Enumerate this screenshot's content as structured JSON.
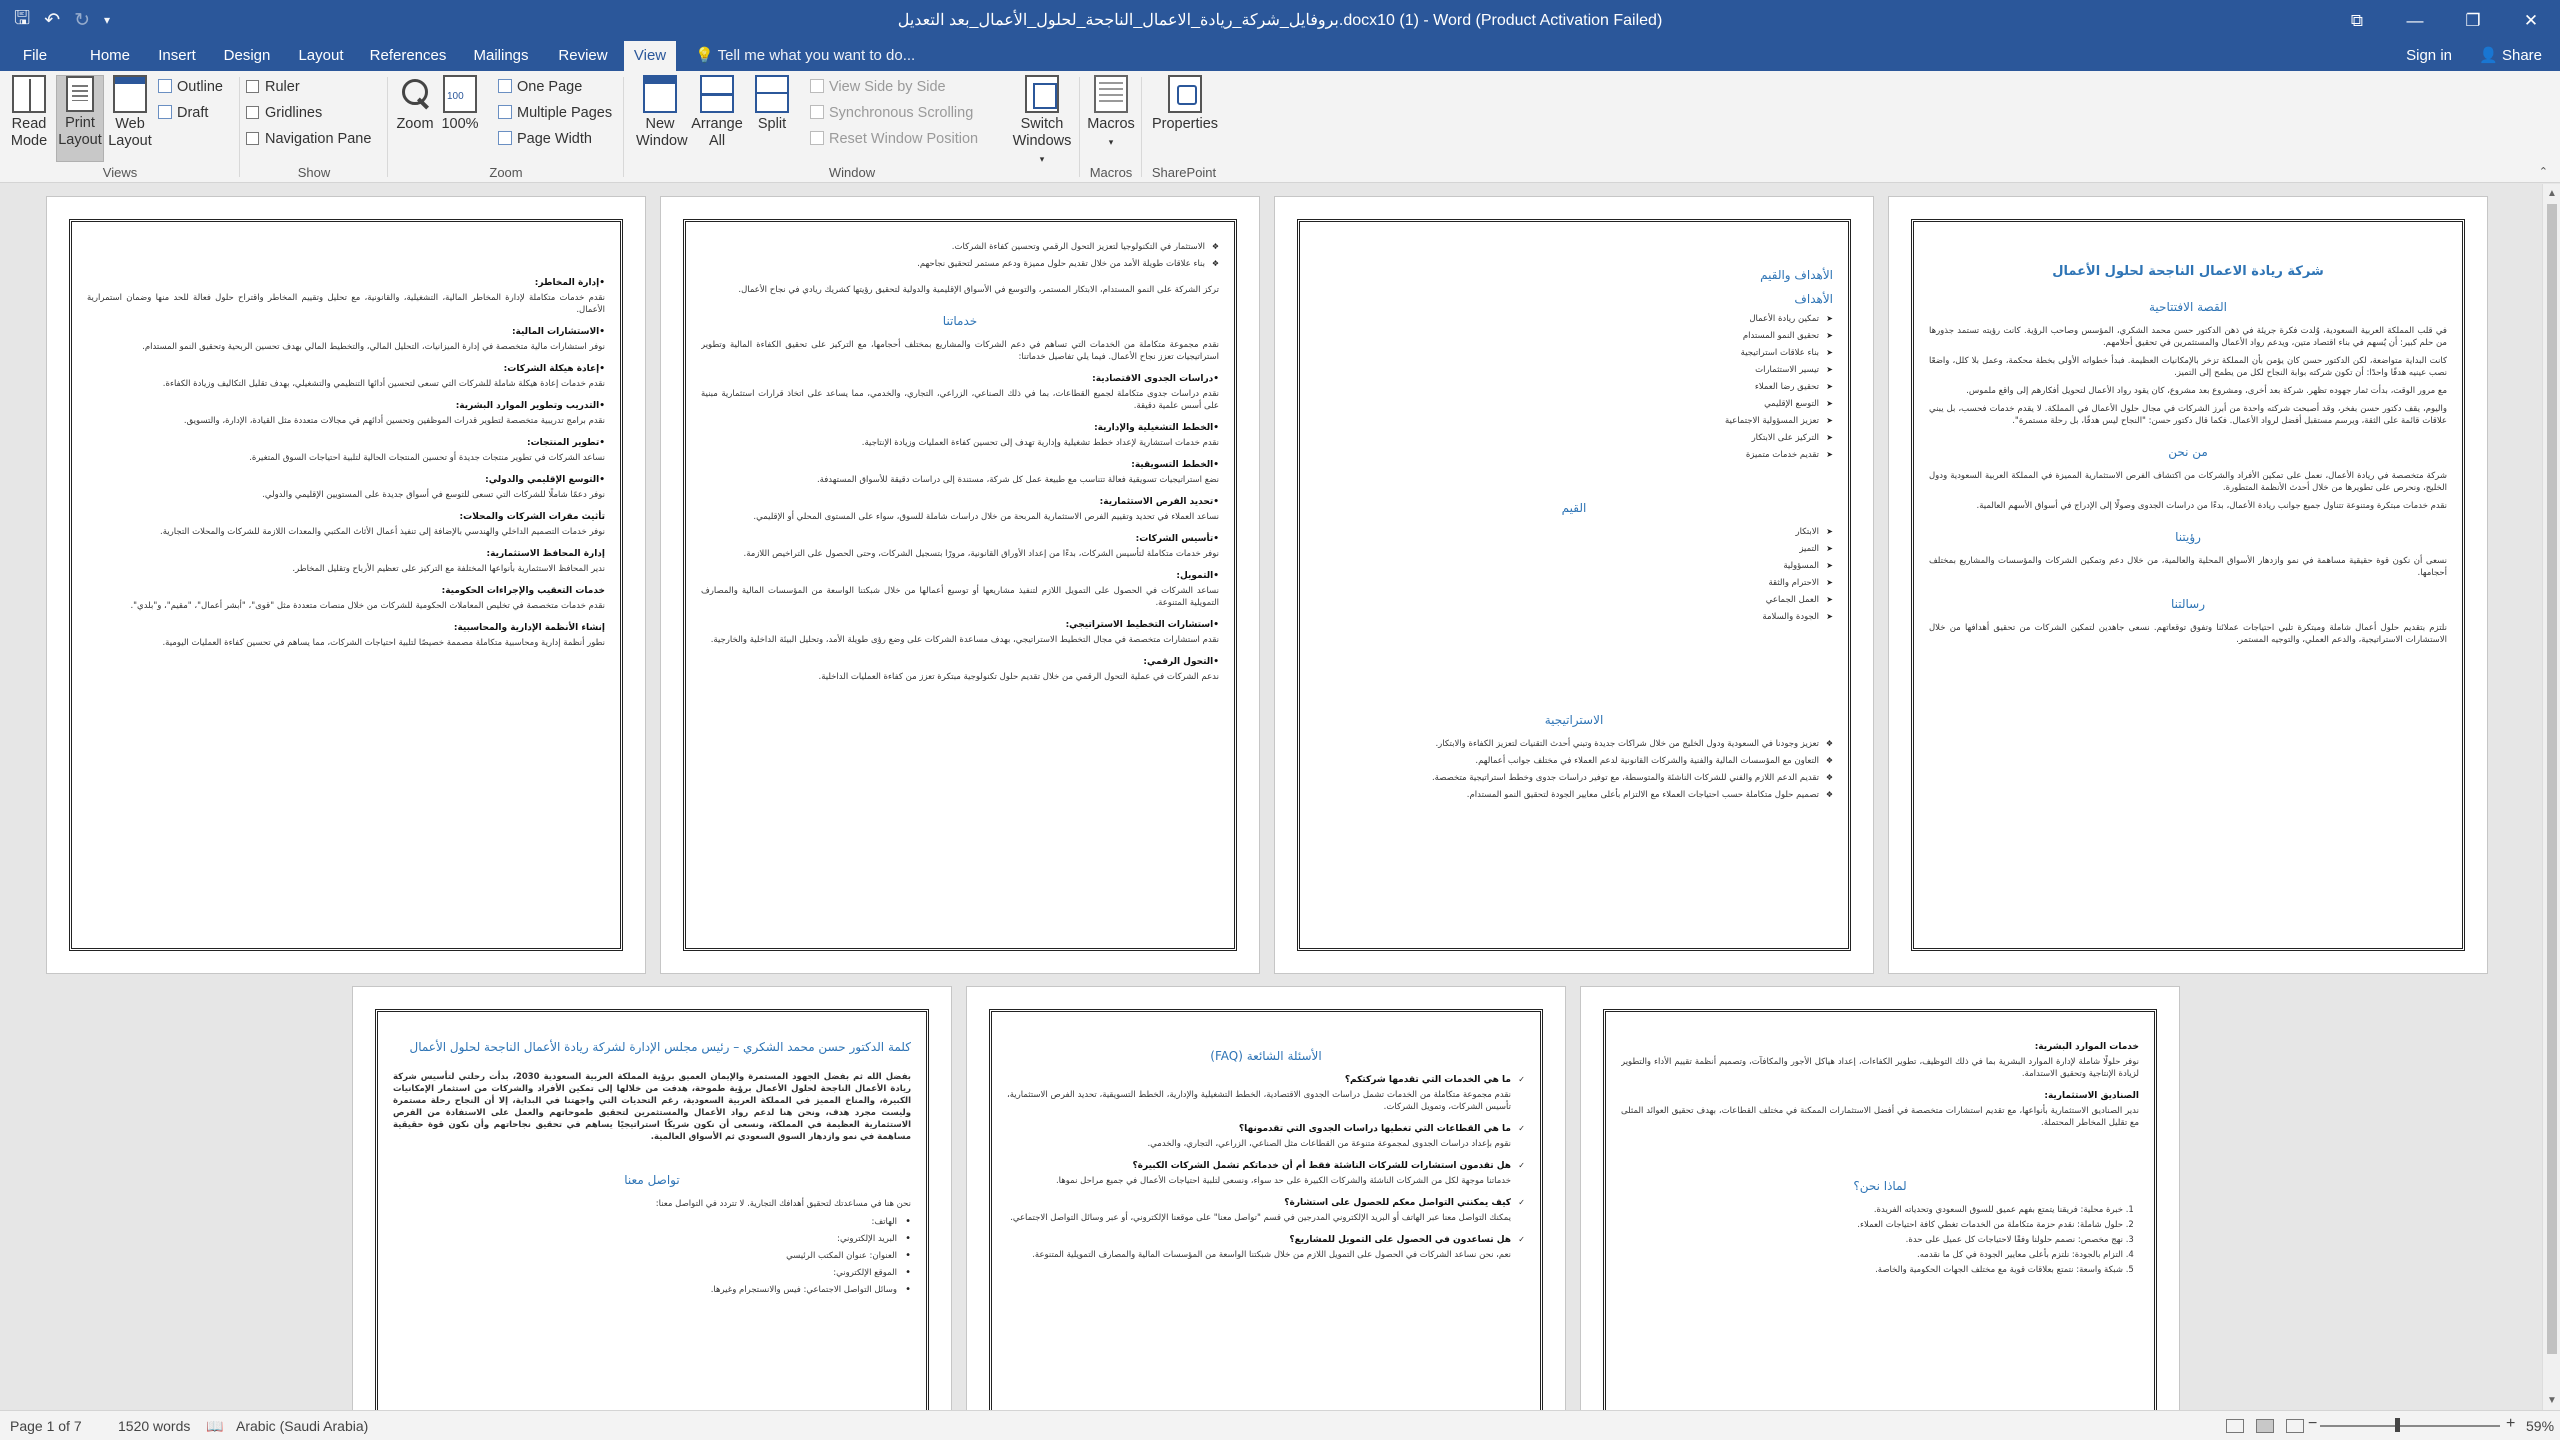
{
  "title_bar": {
    "document_title": "بروفايل_شركة_ريادة_الاعمال_الناجحة_لحلول_الأعمال_بعد التعديل.docx10 (1) - Word (Product Activation Failed)",
    "qat_icons": [
      "save-icon",
      "undo-icon",
      "redo-icon",
      "customize-qat-icon"
    ],
    "controls": [
      "ribbon-display-options-icon",
      "minimize-icon",
      "restore-icon",
      "close-icon"
    ]
  },
  "tabs": {
    "file": "File",
    "items": [
      "Home",
      "Insert",
      "Design",
      "Layout",
      "References",
      "Mailings",
      "Review",
      "View"
    ],
    "active": "View",
    "tell_me": "Tell me what you want to do...",
    "sign_in": "Sign in",
    "share": "Share"
  },
  "ribbon": {
    "views": {
      "label": "Views",
      "read_mode": "Read Mode",
      "print_layout": "Print Layout",
      "web_layout": "Web Layout",
      "outline": "Outline",
      "draft": "Draft"
    },
    "show": {
      "label": "Show",
      "ruler": "Ruler",
      "gridlines": "Gridlines",
      "navigation_pane": "Navigation Pane"
    },
    "zoom": {
      "label": "Zoom",
      "zoom": "Zoom",
      "hundred": "100%",
      "one_page": "One Page",
      "multiple_pages": "Multiple Pages",
      "page_width": "Page Width"
    },
    "window": {
      "label": "Window",
      "new_window": "New Window",
      "arrange_all": "Arrange All",
      "split": "Split",
      "view_side_by_side": "View Side by Side",
      "synchronous_scrolling": "Synchronous Scrolling",
      "reset_window_position": "Reset Window Position",
      "switch_windows": "Switch Windows"
    },
    "macros": {
      "label": "Macros",
      "macros": "Macros"
    },
    "sharepoint": {
      "label": "SharePoint",
      "properties": "Properties"
    }
  },
  "pages": {
    "p1": {
      "title": "شركة ريادة الاعمال الناجحة لحلول الأعمال",
      "h1": "القصة الافتتاحية",
      "para1": "في قلب المملكة العربية السعودية، وُلدت فكرة جريئة في ذهن الدكتور حسن محمد الشكري، المؤسس وصاحب الرؤية. كانت رؤيته تستمد جذورها من حلم كبير: أن يُسهم في بناء اقتصاد متين، ويدعم رواد الأعمال والمستثمرين في تحقيق أحلامهم.",
      "para2": "كانت البداية متواضعة، لكن الدكتور حسن كان يؤمن بأن المملكة تزخر بالإمكانيات العظيمة. فبدأ خطواته الأولى بخطة محكمة، وعمل بلا كلل، واضعًا نصب عينيه هدفًا واحدًا: أن تكون شركته بوابة النجاح لكل من يطمح إلى التميز.",
      "para3": "مع مرور الوقت، بدأت ثمار جهوده تظهر. شركة بعد أخرى، ومشروع بعد مشروع، كان يقود رواد الأعمال لتحويل أفكارهم إلى واقع ملموس.",
      "para4": "واليوم، يقف دكتور حسن بفخر، وقد أصبحت شركته واحدة من أبرز الشركات في مجال حلول الأعمال في المملكة. لا يقدم خدمات فحسب، بل يبني علاقات قائمة على الثقة، ويرسم مستقبل أفضل لرواد الأعمال. فكما قال دكتور حسن: \"النجاح ليس هدفًا، بل رحلة مستمرة\".",
      "h2": "من نحن",
      "para5": "شركة متخصصة في ريادة الأعمال، نعمل على تمكين الأفراد والشركات من اكتشاف الفرص الاستثمارية المميزة في المملكة العربية السعودية ودول الخليج، ونحرص على تطويرها من خلال أحدث الأنظمة المتطورة.",
      "para6": "نقدم خدمات مبتكرة ومتنوعة تتناول جميع جوانب ريادة الأعمال، بدءًا من دراسات الجدوى وصولًا إلى الإدراج في أسواق الأسهم العالمية.",
      "h3": "رؤيتنا",
      "para7": "نسعى أن نكون قوة حقيقية مساهمة في نمو وازدهار الأسواق المحلية والعالمية، من خلال دعم وتمكين الشركات والمؤسسات والمشاريع بمختلف أحجامها.",
      "h4": "رسالتنا",
      "para8": "نلتزم بتقديم حلول أعمال شاملة ومبتكرة تلبي احتياجات عملائنا وتفوق توقعاتهم. نسعى جاهدين لتمكين الشركات من تحقيق أهدافها من خلال الاستشارات الاستراتيجية، والدعم العملي، والتوجيه المستمر."
    },
    "p2": {
      "h1": "الأهداف والقيم",
      "h2": "الأهداف",
      "goals": [
        "تمكين ريادة الأعمال",
        "تحقيق النمو المستدام",
        "بناء علاقات استراتيجية",
        "تيسير الاستثمارات",
        "تحقيق رضا العملاء",
        "التوسع الإقليمي",
        "تعزيز المسؤولية الاجتماعية",
        "التركيز على الابتكار",
        "تقديم خدمات متميزة"
      ],
      "h3": "القيم",
      "values": [
        "الابتكار",
        "التميز",
        "المسؤولية",
        "الاحترام والثقة",
        "العمل الجماعي",
        "الجودة والسلامة"
      ],
      "h4": "الاستراتيجية",
      "strategy": [
        "تعزيز وجودنا في السعودية ودول الخليج من خلال شراكات جديدة وتبني أحدث التقنيات لتعزيز الكفاءة والابتكار.",
        "التعاون مع المؤسسات المالية والفنية والشركات القانونية لدعم العملاء في مختلف جوانب أعمالهم.",
        "تقديم الدعم اللازم والفني للشركات الناشئة والمتوسطة، مع توفير دراسات جدوى وخطط استراتيجية متخصصة.",
        "تصميم حلول متكاملة حسب احتياجات العملاء مع الالتزام بأعلى معايير الجودة لتحقيق النمو المستدام."
      ]
    },
    "p3": {
      "bullets": [
        "الاستثمار في التكنولوجيا لتعزيز التحول الرقمي وتحسين كفاءة الشركات.",
        "بناء علاقات طويلة الأمد من خلال تقديم حلول مميزة ودعم مستمر لتحقيق نجاحهم."
      ],
      "intro": "تركز الشركة على النمو المستدام، الابتكار المستمر، والتوسع في الأسواق الإقليمية والدولية لتحقيق رؤيتها كشريك ريادي في نجاح الأعمال.",
      "h1": "خدماتنا",
      "intro2": "نقدم مجموعة متكاملة من الخدمات التي تساهم في دعم الشركات والمشاريع بمختلف أحجامها، مع التركيز على تحقيق الكفاءة المالية وتطوير استراتيجيات تعزز نجاح الأعمال. فيما يلي تفاصيل خدماتنا:",
      "services": [
        {
          "t": "•دراسات الجدوى الاقتصادية:",
          "d": "نقدم دراسات جدوى متكاملة لجميع القطاعات، بما في ذلك الصناعي، الزراعي، التجاري، والخدمي، مما يساعد على اتخاذ قرارات استثمارية مبنية على أسس علمية دقيقة."
        },
        {
          "t": "•الخطط التشغيلية والإدارية:",
          "d": "نقدم خدمات استشارية لإعداد خطط تشغيلية وإدارية تهدف إلى تحسين كفاءة العمليات وزيادة الإنتاجية."
        },
        {
          "t": "•الخطط التسويقية:",
          "d": "نضع استراتيجيات تسويقية فعالة تتناسب مع طبيعة عمل كل شركة، مستندة إلى دراسات دقيقة للأسواق المستهدفة."
        },
        {
          "t": "•تحديد الفرص الاستثمارية:",
          "d": "نساعد العملاء في تحديد وتقييم الفرص الاستثمارية المربحة من خلال دراسات شاملة للسوق، سواء على المستوى المحلي أو الإقليمي."
        },
        {
          "t": "•تأسيس الشركات:",
          "d": "نوفر خدمات متكاملة لتأسيس الشركات، بدءًا من إعداد الأوراق القانونية، مرورًا بتسجيل الشركات، وحتى الحصول على التراخيص اللازمة."
        },
        {
          "t": "•التمويل:",
          "d": "نساعد الشركات في الحصول على التمويل اللازم لتنفيذ مشاريعها أو توسيع أعمالها من خلال شبكتنا الواسعة من المؤسسات المالية والمصارف التمويلية المتنوعة."
        },
        {
          "t": "•استشارات التخطيط الاستراتيجي:",
          "d": "نقدم استشارات متخصصة في مجال التخطيط الاستراتيجي، بهدف مساعدة الشركات على وضع رؤى طويلة الأمد، وتحليل البيئة الداخلية والخارجية."
        },
        {
          "t": "•التحول الرقمي:",
          "d": "ندعم الشركات في عملية التحول الرقمي من خلال تقديم حلول تكنولوجية مبتكرة تعزز من كفاءة العمليات الداخلية."
        }
      ]
    },
    "p4": {
      "services": [
        {
          "t": "•إدارة المخاطر:",
          "d": "نقدم خدمات متكاملة لإدارة المخاطر المالية، التشغيلية، والقانونية، مع تحليل وتقييم المخاطر واقتراح حلول فعالة للحد منها وضمان استمرارية الأعمال."
        },
        {
          "t": "•الاستشارات المالية:",
          "d": "نوفر استشارات مالية متخصصة في إدارة الميزانيات، التحليل المالي، والتخطيط المالي بهدف تحسين الربحية وتحقيق النمو المستدام."
        },
        {
          "t": "•إعادة هيكلة الشركات:",
          "d": "نقدم خدمات إعادة هيكلة شاملة للشركات التي تسعى لتحسين أدائها التنظيمي والتشغيلي، بهدف تقليل التكاليف وزيادة الكفاءة."
        },
        {
          "t": "•التدريب وتطوير الموارد البشرية:",
          "d": "نقدم برامج تدريبية متخصصة لتطوير قدرات الموظفين وتحسين أدائهم في مجالات متعددة مثل القيادة، الإدارة، والتسويق."
        },
        {
          "t": "•تطوير المنتجات:",
          "d": "نساعد الشركات في تطوير منتجات جديدة أو تحسين المنتجات الحالية لتلبية احتياجات السوق المتغيرة."
        },
        {
          "t": "•التوسع الإقليمي والدولي:",
          "d": "نوفر دعمًا شاملًا للشركات التي تسعى للتوسع في أسواق جديدة على المستويين الإقليمي والدولي."
        },
        {
          "t": "تأثيث مقرات الشركات والمحلات:",
          "d": "نوفر خدمات التصميم الداخلي والهندسي بالإضافة إلى تنفيذ أعمال الأثاث المكتبي والمعدات اللازمة للشركات والمحلات التجارية."
        },
        {
          "t": "إدارة المحافظ الاستثمارية:",
          "d": "ندير المحافظ الاستثمارية بأنواعها المختلفة مع التركيز على تعظيم الأرباح وتقليل المخاطر."
        },
        {
          "t": "خدمات التعقيب والإجراءات الحكومية:",
          "d": "نقدم خدمات متخصصة في تخليص المعاملات الحكومية للشركات من خلال منصات متعددة مثل \"قوى\"، \"أبشر أعمال\"، \"مقيم\"، و\"بلدي\"."
        },
        {
          "t": "إنشاء الأنظمة الإدارية والمحاسبية:",
          "d": "نطور أنظمة إدارية ومحاسبية متكاملة مصممة خصيصًا لتلبية احتياجات الشركات، مما يساهم في تحسين كفاءة العمليات اليومية."
        }
      ]
    },
    "p5": {
      "services": [
        {
          "t": "خدمات الموارد البشرية:",
          "d": "نوفر حلولًا شاملة لإدارة الموارد البشرية بما في ذلك التوظيف، تطوير الكفاءات، إعداد هياكل الأجور والمكافآت، وتصميم أنظمة تقييم الأداء والتطوير لزيادة الإنتاجية وتحقيق الاستدامة."
        },
        {
          "t": "الصناديق الاستثمارية:",
          "d": "ندير الصناديق الاستثمارية بأنواعها، مع تقديم استشارات متخصصة في أفضل الاستثمارات الممكنة في مختلف القطاعات، بهدف تحقيق العوائد المثلى مع تقليل المخاطر المحتملة."
        }
      ],
      "h1": "لماذا نحن؟",
      "why": [
        "خبرة محلية: فريقنا يتمتع بفهم عميق للسوق السعودي وتحدياته الفريدة.",
        "حلول شاملة: نقدم حزمة متكاملة من الخدمات تغطي كافة احتياجات العملاء.",
        "نهج مخصص: نصمم حلولنا وفقًا لاحتياجات كل عميل على حدة.",
        "التزام بالجودة: نلتزم بأعلى معايير الجودة في كل ما نقدمه.",
        "شبكة واسعة: نتمتع بعلاقات قوية مع مختلف الجهات الحكومية والخاصة."
      ]
    },
    "p6": {
      "h1": "الأسئلة الشائعة (FAQ)",
      "faq": [
        {
          "q": "ما هي الخدمات التي تقدمها شركتكم؟",
          "a": "نقدم مجموعة متكاملة من الخدمات تشمل دراسات الجدوى الاقتصادية، الخطط التشغيلية والإدارية، الخطط التسويقية، تحديد الفرص الاستثمارية، تأسيس الشركات، وتمويل الشركات."
        },
        {
          "q": "ما هي القطاعات التي تغطيها دراسات الجدوى التي تقدمونها؟",
          "a": "نقوم بإعداد دراسات الجدوى لمجموعة متنوعة من القطاعات مثل الصناعي، الزراعي، التجاري، والخدمي."
        },
        {
          "q": "هل تقدمون استشارات للشركات الناشئة فقط أم أن خدماتكم تشمل الشركات الكبيرة؟",
          "a": "خدماتنا موجهة لكل من الشركات الناشئة والشركات الكبيرة على حد سواء، ونسعى لتلبية احتياجات الأعمال في جميع مراحل نموها."
        },
        {
          "q": "كيف يمكنني التواصل معكم للحصول على استشارة؟",
          "a": "يمكنك التواصل معنا عبر الهاتف أو البريد الإلكتروني المدرجين في قسم \"تواصل معنا\" على موقعنا الإلكتروني، أو عبر وسائل التواصل الاجتماعي."
        },
        {
          "q": "هل تساعدون في الحصول على التمويل للمشاريع؟",
          "a": "نعم، نحن نساعد الشركات في الحصول على التمويل اللازم من خلال شبكتنا الواسعة من المؤسسات المالية والمصارف التمويلية المتنوعة."
        }
      ]
    },
    "p7": {
      "title": "كلمة الدكتور حسن محمد الشكري – رئيس مجلس الإدارة لشركة ريادة الأعمال الناجحة لحلول الأعمال",
      "para1": "بفضل الله ثم بفضل الجهود المستمرة والإيمان العميق برؤية المملكة العربية السعودية 2030، بدأت رحلتي لتأسيس شركة ريادة الأعمال الناجحة لحلول الأعمال برؤية طموحة، هدفت من خلالها إلى تمكين الأفراد والشركات من استثمار الإمكانيات الكبيرة، والمناخ المميز في المملكة العربية السعودية، رغم التحديات التي واجهتنا في البداية، إلا أن النجاح رحلة مستمرة وليست مجرد هدف، ونحن هنا لدعم رواد الأعمال والمستثمرين لتحقيق طموحاتهم والعمل على الاستفادة من الفرص الاستثمارية العظيمة في المملكة، ونسعى أن نكون شريكًا استراتيجيًا يساهم في تحقيق نجاحاتهم وأن نكون قوة حقيقية مساهمة في نمو وازدهار السوق السعودي ثم الأسواق العالمية.",
      "h1": "تواصل معنا",
      "para2": "نحن هنا في مساعدتك لتحقيق أهدافك التجارية. لا تتردد في التواصل معنا:",
      "contacts": [
        "الهاتف:",
        "البريد الإلكتروني:",
        "العنوان: عنوان المكتب الرئيسي",
        "الموقع الإلكتروني:",
        "وسائل التواصل الاجتماعي: فيس والانستجرام وغيرها."
      ]
    }
  },
  "status_bar": {
    "page": "Page 1 of 7",
    "words": "1520 words",
    "language": "Arabic (Saudi Arabia)",
    "zoom": "59%",
    "zoom_minus": "−",
    "zoom_plus": "+"
  }
}
